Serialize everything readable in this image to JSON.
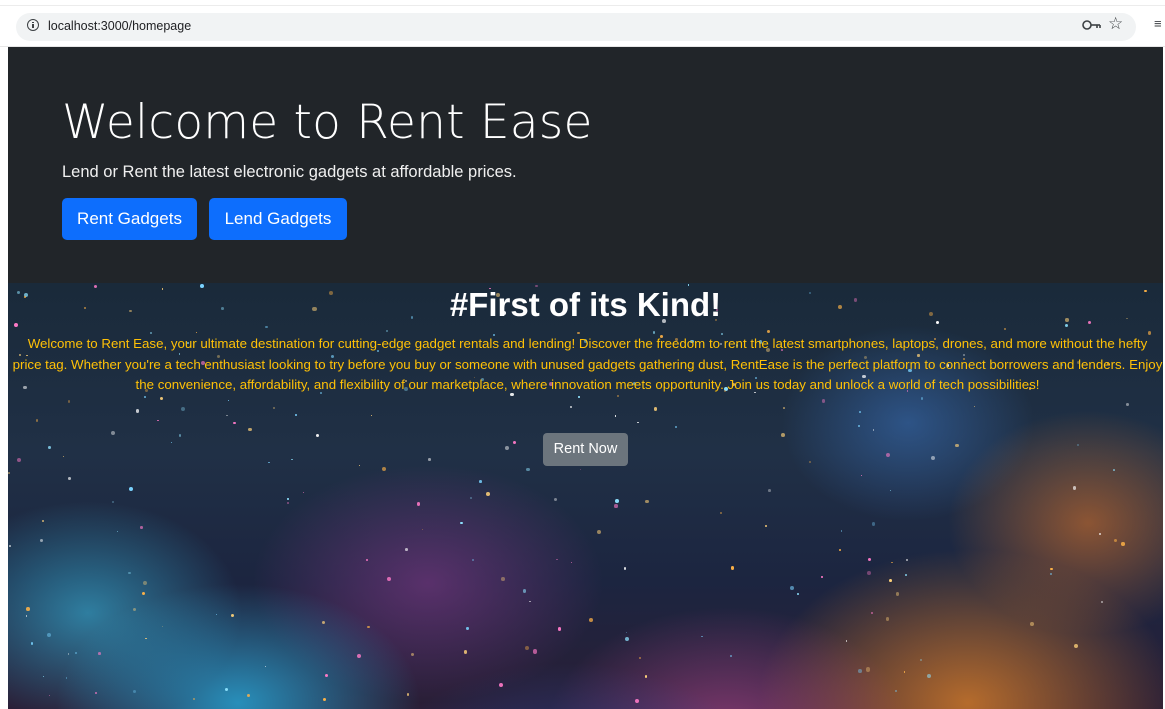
{
  "browser": {
    "url": "localhost:3000/homepage",
    "icons": [
      "info-icon",
      "key-icon",
      "star-icon",
      "menu-icon"
    ]
  },
  "hero": {
    "title": "Welcome to Rent Ease",
    "subtitle": "Lend or Rent the latest electronic gadgets at affordable prices.",
    "rent_button": "Rent Gadgets",
    "lend_button": "Lend Gadgets"
  },
  "banner": {
    "title": "#First of its Kind!",
    "text": "Welcome to Rent Ease, your ultimate destination for cutting-edge gadget rentals and lending! Discover the freedom to rent the latest smartphones, laptops, drones, and more without the hefty price tag. Whether you're a tech enthusiast looking to try before you buy or someone with unused gadgets gathering dust, RentEase is the perfect platform to connect borrowers and lenders. Enjoy the convenience, affordability, and flexibility of our marketplace, where innovation meets opportunity. Join us today and unlock a world of tech possibilities!",
    "button": "Rent Now"
  },
  "colors": {
    "hero_bg": "#212529",
    "primary_button": "#0d6efd",
    "secondary_button": "#6c757d",
    "banner_text": "#ffc107"
  }
}
